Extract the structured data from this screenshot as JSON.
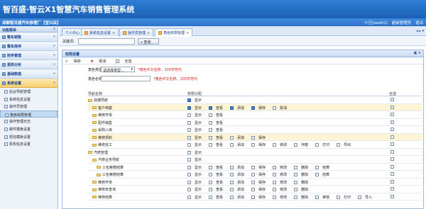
{
  "app": {
    "title": "智百盛·智云X1智慧汽车销售管理系统"
  },
  "subbar": {
    "company": "成都智百盛汽车修理厂【宜兴店】",
    "user": "小汪(test01)",
    "settings": "超级管理员",
    "logout": "退出"
  },
  "sidebar": {
    "header": "功能菜单",
    "modules": [
      {
        "label": "整车销售"
      },
      {
        "label": "整车库存"
      },
      {
        "label": "财务管理"
      },
      {
        "label": "报表分析"
      },
      {
        "label": "基础数据"
      },
      {
        "label": "系统设置"
      }
    ],
    "subitems": [
      {
        "label": "后台导航管理"
      },
      {
        "label": "系统信息设置"
      },
      {
        "label": "操作员管理"
      },
      {
        "label": "角色权限管理"
      },
      {
        "label": "操作管理日志"
      },
      {
        "label": "邮件模板设置"
      },
      {
        "label": "短信模板设置"
      },
      {
        "label": "机构信息设置"
      }
    ]
  },
  "tabs": [
    {
      "label": "个人中心"
    },
    {
      "label": "系统信息设置"
    },
    {
      "label": "操作员管理"
    },
    {
      "label": "角色权限管理"
    }
  ],
  "tabctl": "◂ ▸ ▾",
  "search": {
    "label": "关键词:",
    "button": "查询"
  },
  "panel": {
    "title": "权限设置",
    "toolbar": {
      "save": "保存",
      "cancel": "取消",
      "all": "全选"
    },
    "form": {
      "type_label": "角色类型",
      "type_value": "请选择类型...",
      "type_hint": "*角色中文名称，100字符内",
      "name_label": "角色名称",
      "name_hint": "*角色中文名称，100字符内"
    },
    "grid": {
      "col_nav": "导航名称",
      "col_perm": "权限分配",
      "col_all": "全选",
      "rows": [
        {
          "name": "快捷导航",
          "perms": [
            "显示"
          ]
        },
        {
          "name": "客户档案",
          "perms": [
            "显示",
            "查看",
            "添加",
            "保存",
            "取消"
          ]
        },
        {
          "name": "维修开单",
          "perms": [
            "显示",
            "查看"
          ]
        },
        {
          "name": "配件销售",
          "perms": [
            "显示",
            "查看"
          ]
        },
        {
          "name": "采购入库",
          "perms": [
            "显示",
            "查看"
          ]
        },
        {
          "name": "维修领料",
          "perms": [
            "显示",
            "查看",
            "添加",
            "保存"
          ]
        },
        {
          "name": "维修完工",
          "perms": [
            "显示",
            "查看",
            "添加",
            "保存",
            "修改",
            "作废",
            "打印",
            "导出"
          ]
        },
        {
          "name": "汽修管理",
          "perms": [
            "显示"
          ]
        },
        {
          "name": "汽修业务导航",
          "perms": [
            "显示"
          ]
        },
        {
          "name": "三包索赔结算",
          "perms": [
            "显示",
            "查看",
            "添加",
            "保存",
            "修改",
            "删除",
            "结算"
          ]
        },
        {
          "name": "三包索赔结算",
          "perms": [
            "显示",
            "查看",
            "添加",
            "保存",
            "修改",
            "删除",
            "结算"
          ]
        },
        {
          "name": "维修开单",
          "perms": [
            "显示",
            "查看",
            "添加",
            "保存",
            "修改",
            "删除"
          ]
        },
        {
          "name": "维修单查询",
          "perms": [
            "显示",
            "查看",
            "添加",
            "保存",
            "修改",
            "删除"
          ]
        },
        {
          "name": "维修结算",
          "perms": [
            "显示",
            "查看",
            "添加",
            "保存",
            "修改",
            "删除",
            "审核",
            "打印",
            "导入"
          ]
        }
      ]
    }
  },
  "colors": {
    "accent": "#1b5fb6",
    "hint": "#d61f1f",
    "highlight": "#fdf4d5"
  }
}
